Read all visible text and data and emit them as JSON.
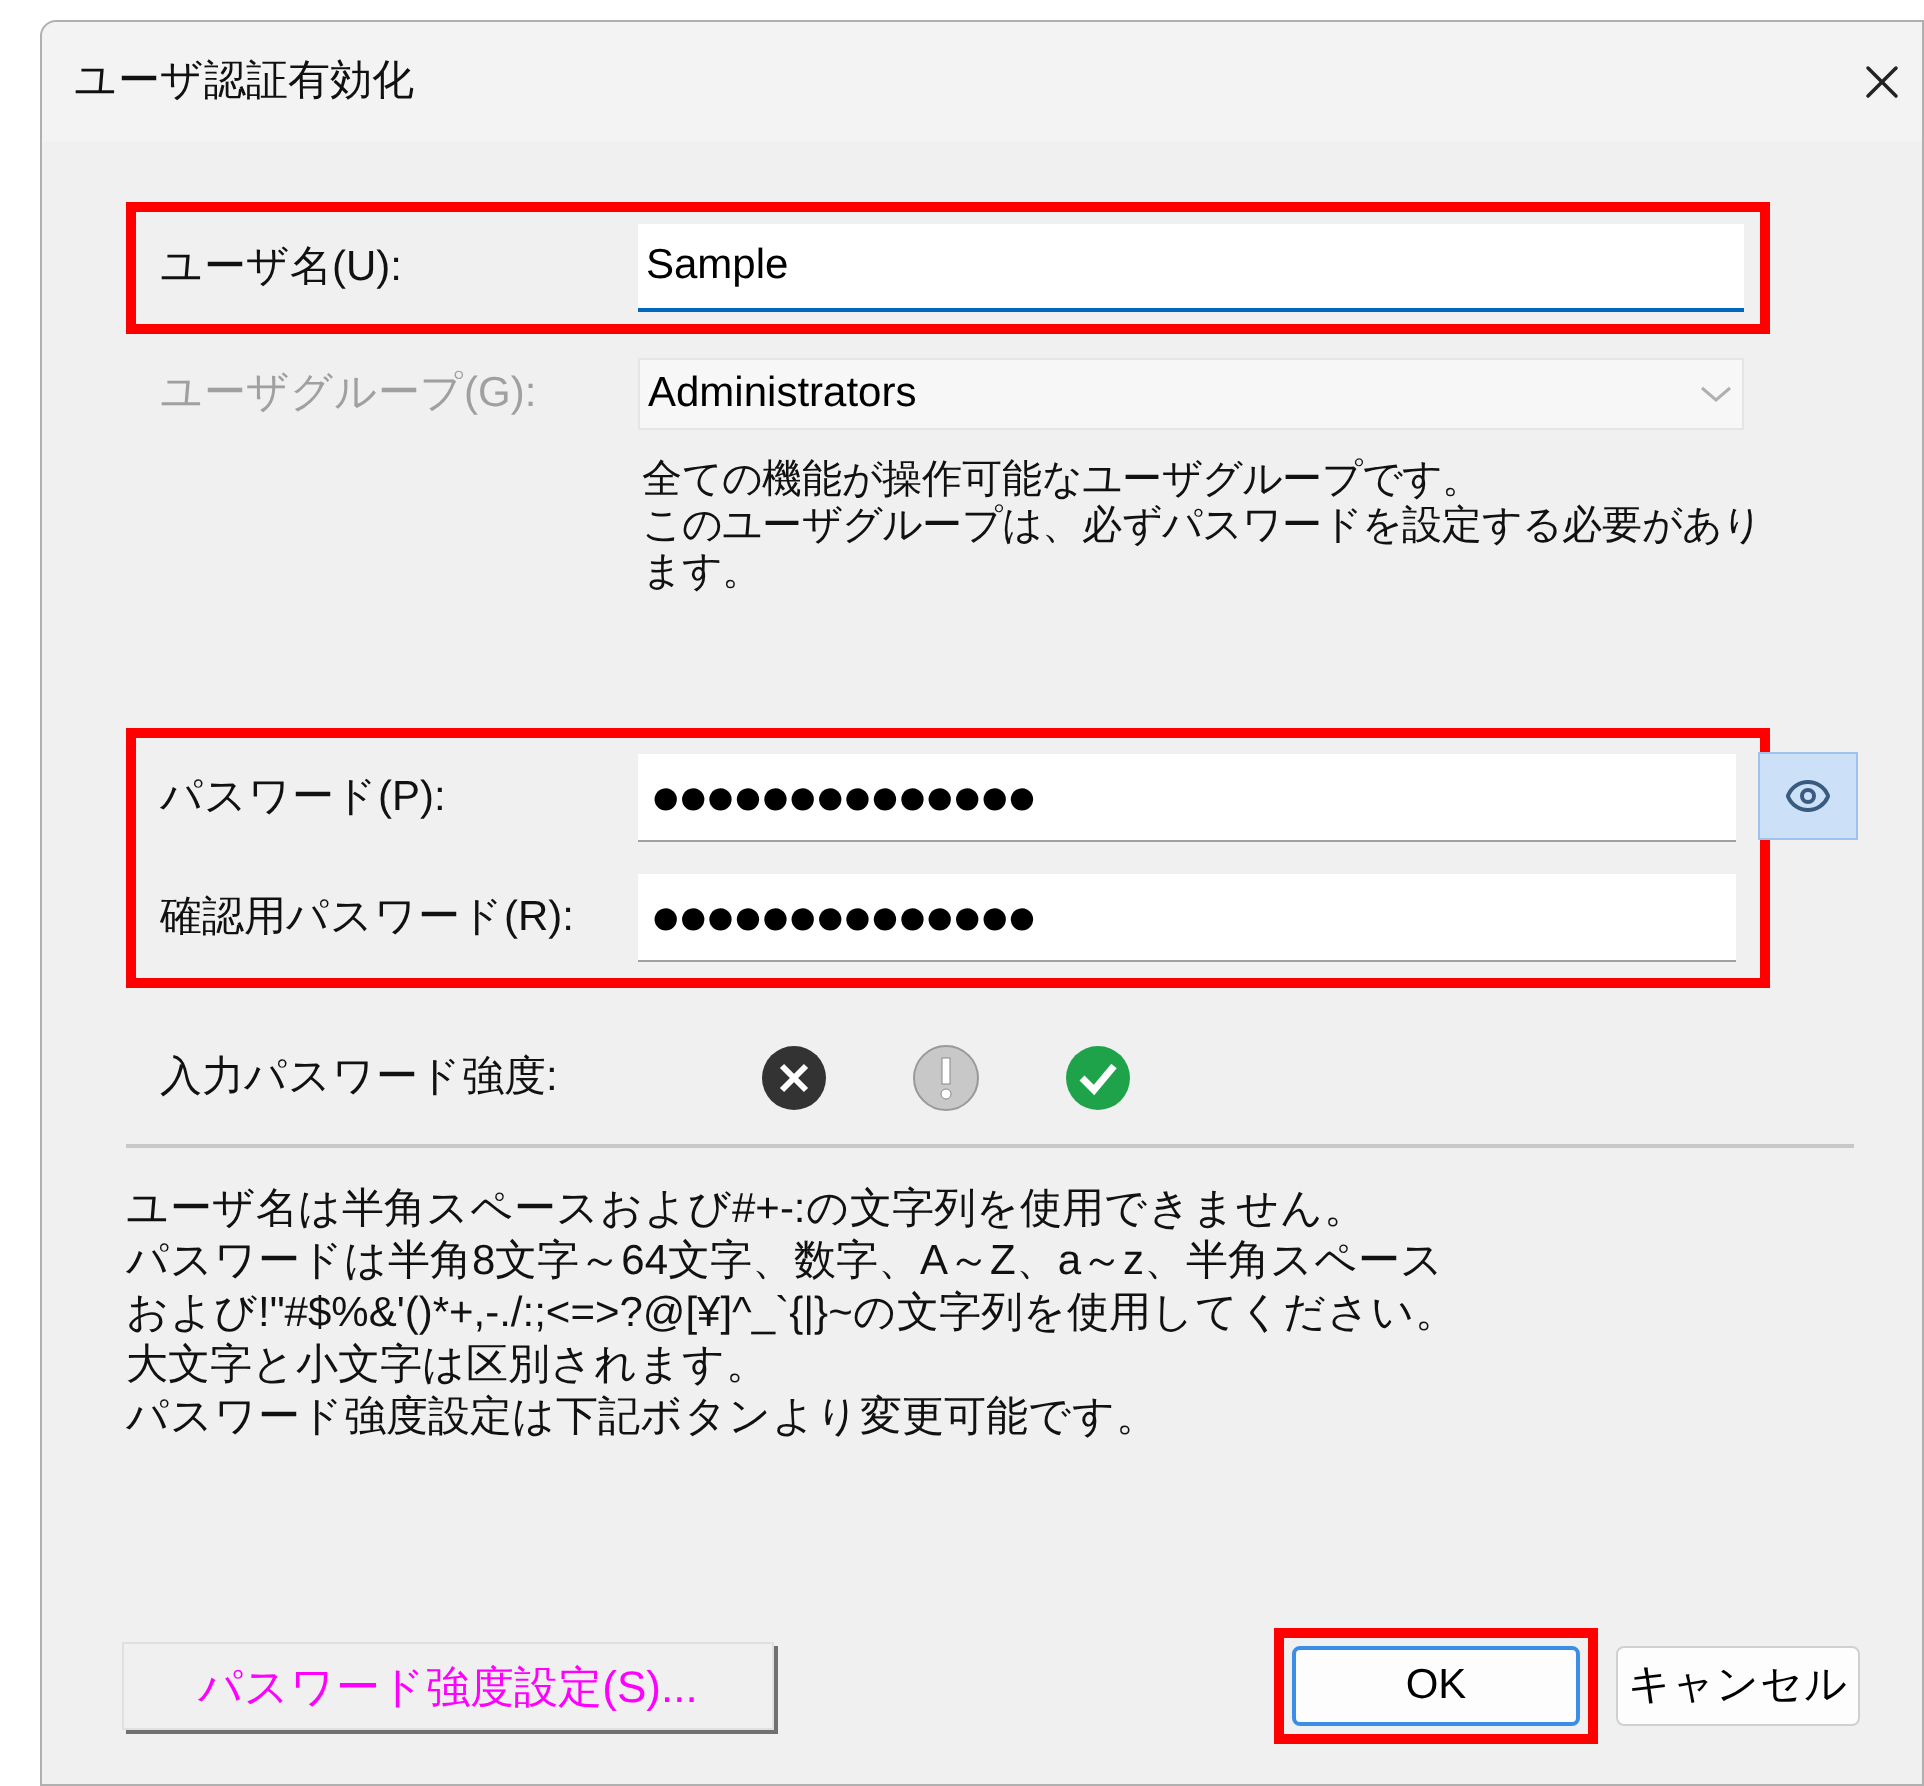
{
  "window": {
    "title": "ユーザ認証有効化"
  },
  "user_name": {
    "label": "ユーザ名(U):",
    "value": "Sample",
    "focused": true,
    "highlighted": true
  },
  "user_group": {
    "label": "ユーザグループ(G):",
    "value": "Administrators",
    "disabled": true,
    "description": [
      "全ての機能が操作可能なユーザグループです。",
      "このユーザグループは、必ずパスワードを設定する必要があり",
      "ます。"
    ]
  },
  "password_group": {
    "highlighted": true,
    "fields": [
      {
        "label": "パスワード(P):",
        "value": "●●●●●●●●●●●●●●"
      },
      {
        "label": "確認用パスワード(R):",
        "value": "●●●●●●●●●●●●●●"
      }
    ]
  },
  "strength": {
    "label": "入力パスワード強度:"
  },
  "notes": [
    "ユーザ名は半角スペースおよび#+-:の文字列を使用できません。",
    "パスワードは半角8文字～64文字、数字、A～Z、a～z、半角スペース",
    "および!\"#$%&'()*+,-./:;<=>?@[¥]^_`{|}~の文字列を使用してください。",
    "大文字と小文字は区別されます。",
    "パスワード強度設定は下記ボタンより変更可能です。"
  ],
  "buttons": [
    {
      "kind": "strength",
      "label": "パスワード強度設定(S)...",
      "highlighted": false
    },
    {
      "kind": "ok",
      "label": "OK",
      "highlighted": true
    },
    {
      "kind": "cancel",
      "label": "キャンセル",
      "highlighted": false
    }
  ]
}
